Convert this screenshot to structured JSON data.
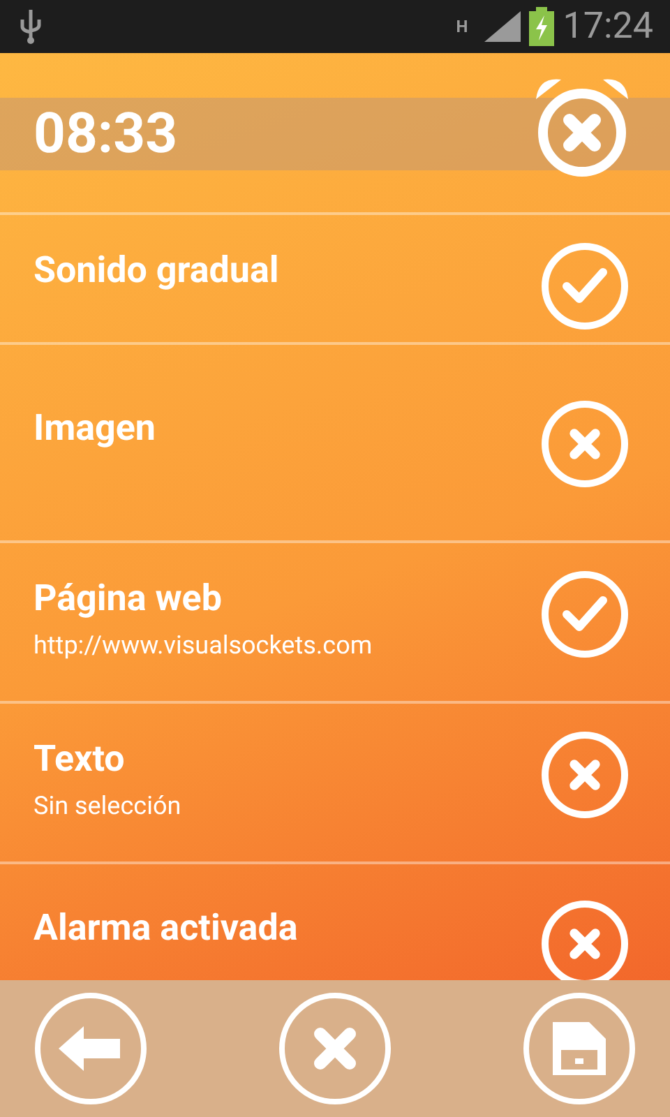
{
  "status_bar": {
    "time": "17:24",
    "network": "H"
  },
  "alarm": {
    "time": "08:33",
    "enabled": false
  },
  "settings": [
    {
      "title": "Sonido gradual",
      "checked": true
    },
    {
      "title": "Imagen",
      "checked": false
    },
    {
      "title": "Página web",
      "subtitle": "http://www.visualsockets.com",
      "checked": true
    },
    {
      "title": "Texto",
      "subtitle": "Sin selección",
      "checked": false
    },
    {
      "title": "Alarma activada",
      "checked": false
    }
  ],
  "toolbar": [
    {
      "kind": "back"
    },
    {
      "kind": "cancel"
    },
    {
      "kind": "save"
    }
  ]
}
